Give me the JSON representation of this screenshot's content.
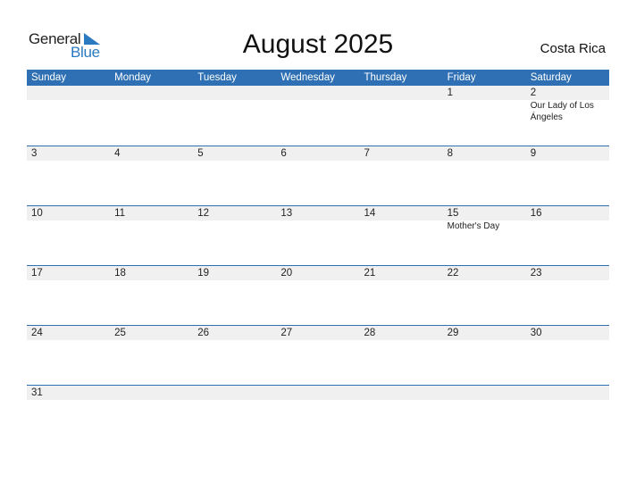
{
  "brand": {
    "word1": "General",
    "word2": "Blue",
    "accent": "#2a7ac2"
  },
  "title": "August 2025",
  "country": "Costa Rica",
  "colors": {
    "header_bg": "#2e70b3",
    "row_band": "#f0f0f0"
  },
  "weekdays": [
    "Sunday",
    "Monday",
    "Tuesday",
    "Wednesday",
    "Thursday",
    "Friday",
    "Saturday"
  ],
  "weeks": [
    [
      {
        "day": ""
      },
      {
        "day": ""
      },
      {
        "day": ""
      },
      {
        "day": ""
      },
      {
        "day": ""
      },
      {
        "day": "1"
      },
      {
        "day": "2",
        "event": "Our Lady of Los Ángeles"
      }
    ],
    [
      {
        "day": "3"
      },
      {
        "day": "4"
      },
      {
        "day": "5"
      },
      {
        "day": "6"
      },
      {
        "day": "7"
      },
      {
        "day": "8"
      },
      {
        "day": "9"
      }
    ],
    [
      {
        "day": "10"
      },
      {
        "day": "11"
      },
      {
        "day": "12"
      },
      {
        "day": "13"
      },
      {
        "day": "14"
      },
      {
        "day": "15",
        "event": "Mother's Day"
      },
      {
        "day": "16"
      }
    ],
    [
      {
        "day": "17"
      },
      {
        "day": "18"
      },
      {
        "day": "19"
      },
      {
        "day": "20"
      },
      {
        "day": "21"
      },
      {
        "day": "22"
      },
      {
        "day": "23"
      }
    ],
    [
      {
        "day": "24"
      },
      {
        "day": "25"
      },
      {
        "day": "26"
      },
      {
        "day": "27"
      },
      {
        "day": "28"
      },
      {
        "day": "29"
      },
      {
        "day": "30"
      }
    ],
    [
      {
        "day": "31"
      },
      {
        "day": ""
      },
      {
        "day": ""
      },
      {
        "day": ""
      },
      {
        "day": ""
      },
      {
        "day": ""
      },
      {
        "day": ""
      }
    ]
  ]
}
